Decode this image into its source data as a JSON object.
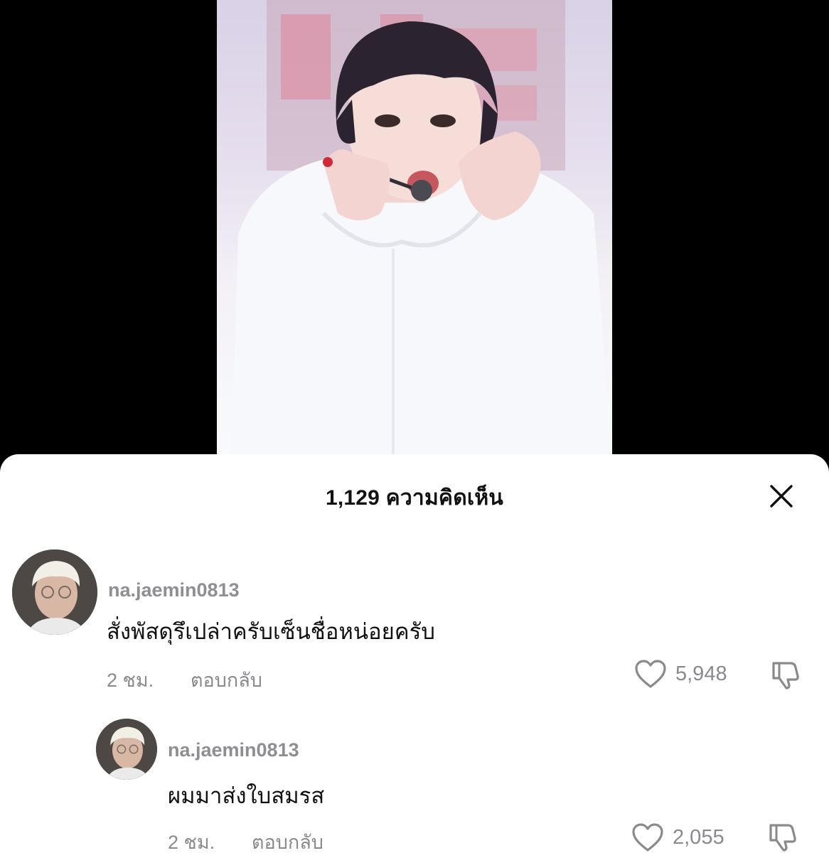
{
  "sheet": {
    "title": "1,129 ความคิดเห็น"
  },
  "comments": [
    {
      "username": "na.jaemin0813",
      "text": "สั่งพัสดุรึเปล่าครับเซ็นชื่อหน่อยครับ",
      "time": "2 ชม.",
      "reply_label": "ตอบกลับ",
      "likes": "5,948"
    },
    {
      "username": "na.jaemin0813",
      "text": "ผมมาส่งใบสมรส",
      "time": "2 ชม.",
      "reply_label": "ตอบกลับ",
      "likes": "2,055"
    }
  ],
  "icons": {
    "close": "close-icon",
    "like": "heart-icon",
    "dislike": "thumbs-down-icon"
  },
  "colors": {
    "sheet_bg": "#ffffff",
    "muted_text": "#8a8a8e",
    "primary_text": "#111111"
  }
}
